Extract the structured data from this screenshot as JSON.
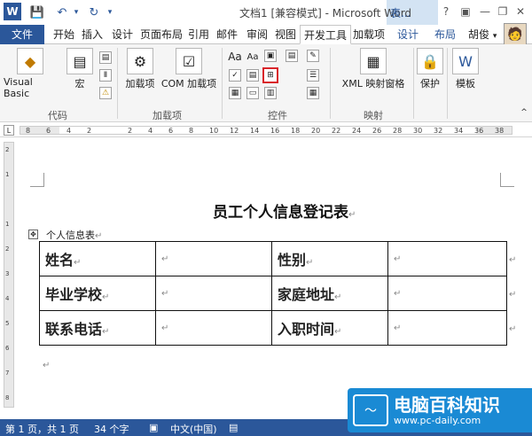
{
  "titlebar": {
    "title": "文档1 [兼容模式] - Microsoft Word",
    "context_tab": "表...",
    "help": "?",
    "ribbon_opts": "▣",
    "minimize": "—",
    "restore": "❐",
    "close": "✕"
  },
  "qat": {
    "logo": "W",
    "save": "💾",
    "undo": "↶",
    "redo": "↻",
    "customize": "▾"
  },
  "tabs": [
    "文件",
    "开始",
    "插入",
    "设计",
    "页面布局",
    "引用",
    "邮件",
    "审阅",
    "视图",
    "开发工具",
    "加载项",
    "设计",
    "布局"
  ],
  "user": {
    "name": "胡俊",
    "arrow": "▾"
  },
  "ribbon": {
    "code_group": {
      "label": "代码",
      "vb": "Visual Basic",
      "macro": "宏"
    },
    "addins_group": {
      "label": "加载项",
      "addins": "加载项",
      "com": "COM 加载项"
    },
    "controls_group": {
      "label": "控件",
      "aa1": "Aa",
      "aa2": "Aa"
    },
    "mapping_group": {
      "label": "映射",
      "xml": "XML 映射窗格"
    },
    "protect": "保护",
    "template": "模板"
  },
  "ruler": {
    "tab_symbol": "L",
    "marks": [
      "8",
      "6",
      "4",
      "2",
      "",
      "2",
      "4",
      "6",
      "8",
      "10",
      "12",
      "14",
      "16",
      "18",
      "20",
      "22",
      "24",
      "26",
      "28",
      "30",
      "32",
      "34",
      "36",
      "38"
    ],
    "vmarks": [
      "2",
      "1",
      "",
      "1",
      "2",
      "3",
      "4",
      "5",
      "6",
      "7",
      "8"
    ]
  },
  "document": {
    "heading": "员工个人信息登记表",
    "para_mark": "↵",
    "table_caption": "个人信息表",
    "move_handle": "✥",
    "rows": [
      [
        "姓名",
        "性别"
      ],
      [
        "毕业学校",
        "家庭地址"
      ],
      [
        "联系电话",
        "入职时间"
      ]
    ]
  },
  "status": {
    "page": "第 1 页，共 1 页",
    "words": "34 个字",
    "lang": "中文(中国)"
  },
  "watermark": {
    "title": "电脑百科知识",
    "url": "www.pc-daily.com"
  }
}
